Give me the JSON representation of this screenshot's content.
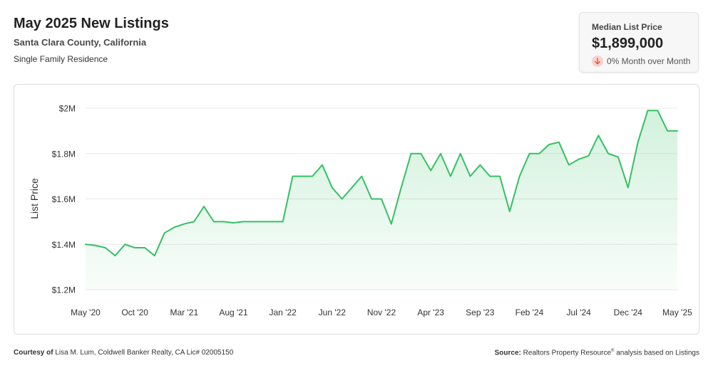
{
  "header": {
    "title": "May 2025 New Listings",
    "subtitle": "Santa Clara County, California",
    "property_type": "Single Family Residence"
  },
  "kpi": {
    "label": "Median List Price",
    "value": "$1,899,000",
    "change_text": "0% Month over Month",
    "change_direction": "down",
    "change_color": "#e5533d"
  },
  "footer": {
    "courtesy_label": "Courtesy of",
    "courtesy_text": "Lisa M. Lum, Coldwell Banker Realty, CA Lic# 02005150",
    "source_label": "Source:",
    "source_text_pre": "Realtors Property Resource",
    "source_sup": "®",
    "source_text_post": " analysis based on Listings"
  },
  "colors": {
    "line": "#34c163",
    "fill": "#34c163",
    "grid": "#e8e8e8",
    "text": "#333333"
  },
  "chart_data": {
    "type": "area",
    "ylabel": "List Price",
    "xlabel": "",
    "ylim": [
      1.2,
      2.0
    ],
    "y_ticks": [
      {
        "value": 2.0,
        "label": "$2M"
      },
      {
        "value": 1.8,
        "label": "$1.8M"
      },
      {
        "value": 1.6,
        "label": "$1.6M"
      },
      {
        "value": 1.4,
        "label": "$1.4M"
      },
      {
        "value": 1.2,
        "label": "$1.2M"
      }
    ],
    "x_ticks": [
      {
        "index": 0,
        "label": "May '20"
      },
      {
        "index": 5,
        "label": "Oct '20"
      },
      {
        "index": 10,
        "label": "Mar '21"
      },
      {
        "index": 15,
        "label": "Aug '21"
      },
      {
        "index": 20,
        "label": "Jan '22"
      },
      {
        "index": 25,
        "label": "Jun '22"
      },
      {
        "index": 30,
        "label": "Nov '22"
      },
      {
        "index": 35,
        "label": "Apr '23"
      },
      {
        "index": 40,
        "label": "Sep '23"
      },
      {
        "index": 45,
        "label": "Feb '24"
      },
      {
        "index": 50,
        "label": "Jul '24"
      },
      {
        "index": 55,
        "label": "Dec '24"
      },
      {
        "index": 60,
        "label": "May '25"
      }
    ],
    "grid": true,
    "units": "millions USD",
    "series": [
      {
        "values": [
          1.4,
          1.395,
          1.385,
          1.35,
          1.4,
          1.385,
          1.385,
          1.35,
          1.45,
          1.475,
          1.49,
          1.5,
          1.567,
          1.5,
          1.5,
          1.495,
          1.5,
          1.5,
          1.5,
          1.5,
          1.5,
          1.7,
          1.7,
          1.7,
          1.75,
          1.65,
          1.6,
          1.65,
          1.7,
          1.6,
          1.6,
          1.49,
          1.65,
          1.8,
          1.8,
          1.725,
          1.8,
          1.7,
          1.8,
          1.7,
          1.75,
          1.7,
          1.7,
          1.545,
          1.7,
          1.8,
          1.8,
          1.84,
          1.85,
          1.75,
          1.775,
          1.79,
          1.88,
          1.8,
          1.785,
          1.65,
          1.85,
          1.99,
          1.99,
          1.9,
          1.9
        ]
      }
    ]
  }
}
